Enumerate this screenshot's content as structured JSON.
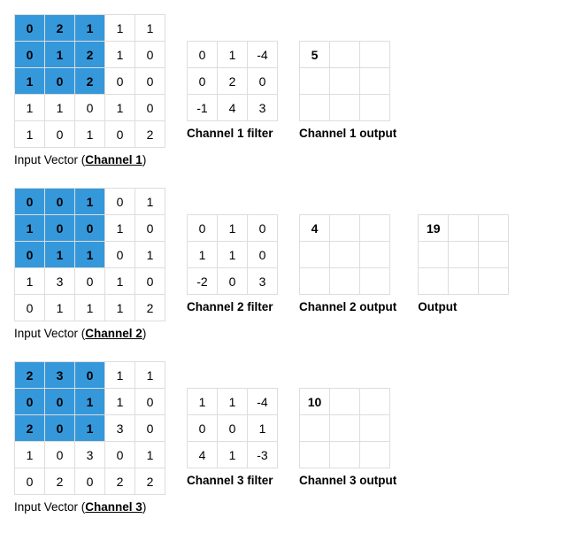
{
  "channels": [
    {
      "input": [
        [
          0,
          2,
          1,
          1,
          1
        ],
        [
          0,
          1,
          2,
          1,
          0
        ],
        [
          1,
          0,
          2,
          0,
          0
        ],
        [
          1,
          1,
          0,
          1,
          0
        ],
        [
          1,
          0,
          1,
          0,
          2
        ]
      ],
      "input_caption_prefix": "Input Vector (",
      "input_caption_bold": "Channel 1",
      "filter": [
        [
          0,
          1,
          -4
        ],
        [
          0,
          2,
          0
        ],
        [
          -1,
          4,
          3
        ]
      ],
      "filter_caption": "Channel 1 filter",
      "output": "5",
      "output_caption": "Channel 1 output"
    },
    {
      "input": [
        [
          0,
          0,
          1,
          0,
          1
        ],
        [
          1,
          0,
          0,
          1,
          0
        ],
        [
          0,
          1,
          1,
          0,
          1
        ],
        [
          1,
          3,
          0,
          1,
          0
        ],
        [
          0,
          1,
          1,
          1,
          2
        ]
      ],
      "input_caption_prefix": "Input Vector (",
      "input_caption_bold": "Channel 2",
      "filter": [
        [
          0,
          1,
          0
        ],
        [
          1,
          1,
          0
        ],
        [
          -2,
          0,
          3
        ]
      ],
      "filter_caption": "Channel 2 filter",
      "output": "4",
      "output_caption": "Channel 2 output"
    },
    {
      "input": [
        [
          2,
          3,
          0,
          1,
          1
        ],
        [
          0,
          0,
          1,
          1,
          0
        ],
        [
          2,
          0,
          1,
          3,
          0
        ],
        [
          1,
          0,
          3,
          0,
          1
        ],
        [
          0,
          2,
          0,
          2,
          2
        ]
      ],
      "input_caption_prefix": "Input Vector (",
      "input_caption_bold": "Channel 3",
      "filter": [
        [
          1,
          1,
          -4
        ],
        [
          0,
          0,
          1
        ],
        [
          4,
          1,
          -3
        ]
      ],
      "filter_caption": "Channel 3 filter",
      "output": "10",
      "output_caption": "Channel 3 output"
    }
  ],
  "final_output": "19",
  "final_output_caption": "Output",
  "paren_close": ")"
}
